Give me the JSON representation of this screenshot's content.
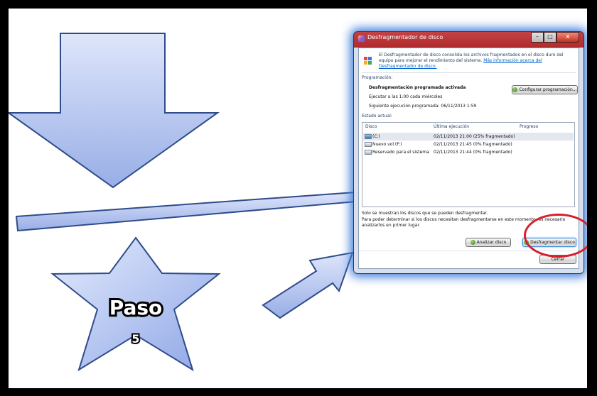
{
  "slide": {
    "star_title": "Paso",
    "star_number": "5"
  },
  "window": {
    "title": "Desfragmentador de disco",
    "intro_text": "El Desfragmentador de disco consolida los archivos fragmentados en el disco duro del equipo para mejorar el rendimiento del sistema.",
    "intro_link": "Más información acerca del Desfragmentador de disco.",
    "schedule_heading": "Programación:",
    "schedule_title": "Desfragmentación programada activada",
    "schedule_time": "Ejecutar a las 1:00 cada miércoles",
    "schedule_next": "Siguiente ejecución programada: 06/11/2013 1:59",
    "configure_button": "Configurar programación...",
    "status_heading": "Estado actual:",
    "columns": {
      "disk": "Disco",
      "last_run": "Última ejecución",
      "progress": "Progreso"
    },
    "disks": [
      {
        "name": "(C:)",
        "last_run": "02/11/2013 21:00 (25% fragmentado)",
        "progress": ""
      },
      {
        "name": "Nuevo vol (F:)",
        "last_run": "02/11/2013 21:45 (0% fragmentado)",
        "progress": ""
      },
      {
        "name": "Reservado para el sistema",
        "last_run": "02/11/2013 21:44 (0% fragmentado)",
        "progress": ""
      }
    ],
    "note1": "Solo se muestran los discos que se pueden desfragmentar.",
    "note2": "Para poder determinar si los discos necesitan desfragmentarse en este momento, es necesario analizarlos en primer lugar.",
    "analyze_button": "Analizar disco",
    "defrag_button": "Desfragmentar disco",
    "close_button": "Cerrar"
  },
  "colors": {
    "arrow_fill": "#b9c8f2",
    "arrow_stroke": "#2f4c8a",
    "highlight_ring": "#d6202a",
    "window_glow": "#3c7bd8"
  }
}
